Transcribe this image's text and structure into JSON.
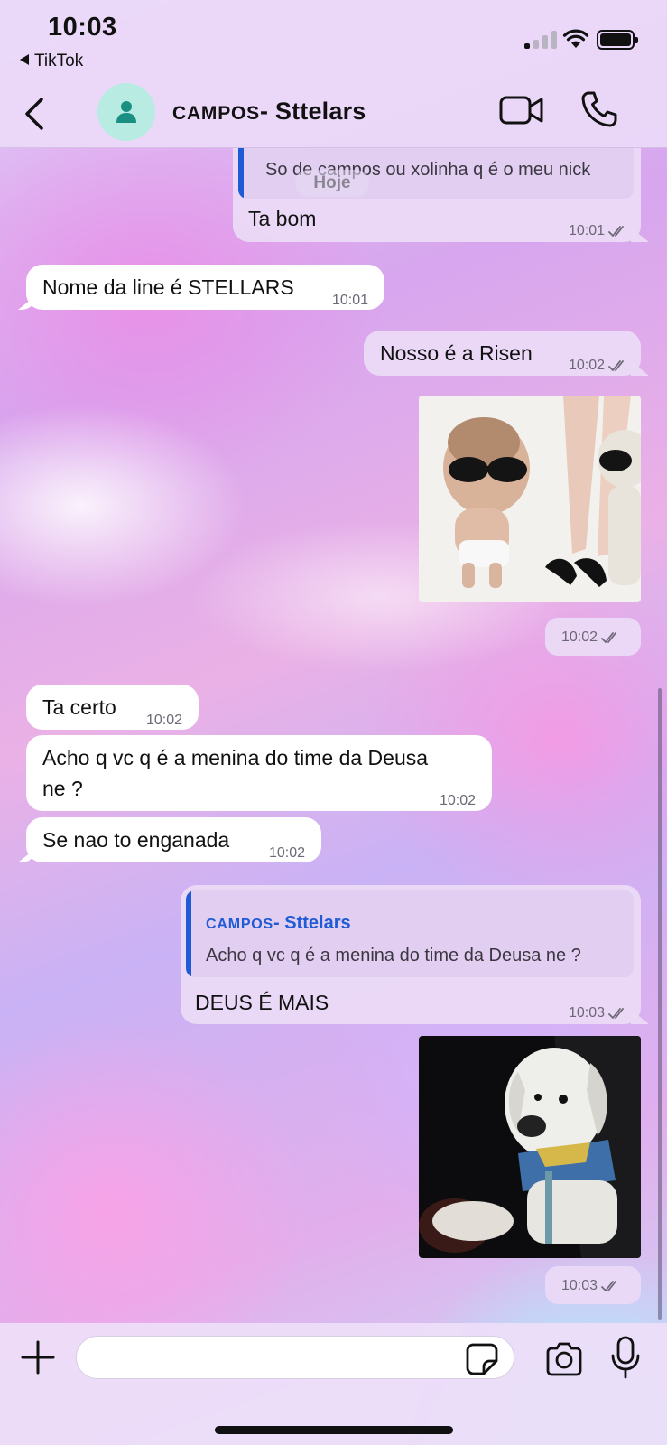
{
  "status_bar": {
    "time": "10:03",
    "back_app": "TikTok"
  },
  "header": {
    "name_prefix": "CAMPOS",
    "name_suffix": "- Sttelars",
    "icons": [
      "back-chevron-icon",
      "person-icon",
      "video-camera-icon",
      "phone-icon"
    ]
  },
  "date_separator": "Hoje",
  "messages": [
    {
      "id": "m1",
      "direction": "outgoing",
      "quote_text": "So de campos ou xolinha q é o meu nick",
      "text": "Ta bom",
      "time": "10:01",
      "status": "read"
    },
    {
      "id": "m2",
      "direction": "incoming",
      "text": "Nome da line é STELLARS",
      "time": "10:01"
    },
    {
      "id": "m3",
      "direction": "outgoing",
      "text": "Nosso é a Risen",
      "time": "10:02",
      "status": "read"
    },
    {
      "id": "m4",
      "direction": "outgoing",
      "type": "sticker",
      "time": "10:02",
      "status": "read"
    },
    {
      "id": "m5",
      "direction": "incoming",
      "text": "Ta certo",
      "time": "10:02"
    },
    {
      "id": "m6",
      "direction": "incoming",
      "text_line1": "Acho q vc q é a menina do time da Deusa",
      "text_line2": "ne ?",
      "time": "10:02"
    },
    {
      "id": "m7",
      "direction": "incoming",
      "text": "Se nao to enganada",
      "time": "10:02"
    },
    {
      "id": "m8",
      "direction": "outgoing",
      "quote_author_prefix": "CAMPOS",
      "quote_author_suffix": "- Sttelars",
      "quote_text": "Acho q vc q é a menina do time da Deusa ne ?",
      "text": "DEUS É MAIS",
      "time": "10:03",
      "status": "read"
    },
    {
      "id": "m9",
      "direction": "outgoing",
      "type": "sticker",
      "time": "10:03",
      "status": "read"
    }
  ],
  "composer": {
    "placeholder": "",
    "icons": [
      "plus-icon",
      "sticker-icon",
      "camera-icon",
      "microphone-icon"
    ]
  },
  "colors": {
    "accent_blue": "#1f5bd4",
    "avatar_bg": "#b8ebe2",
    "avatar_icon": "#1a8f82",
    "outgoing_bubble": "#eadaf6",
    "incoming_bubble": "#ffffff"
  }
}
